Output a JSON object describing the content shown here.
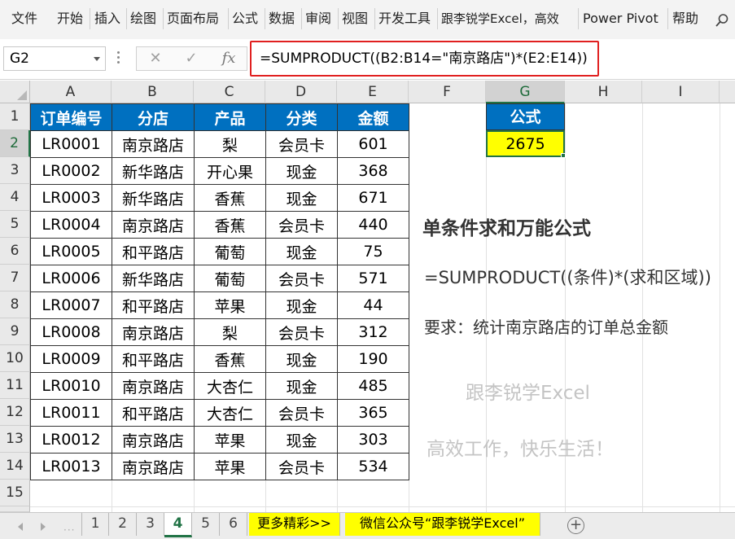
{
  "ribbon": {
    "tabs": [
      "文件",
      "开始",
      "插入",
      "绘图",
      "页面布局",
      "公式",
      "数据",
      "审阅",
      "视图",
      "开发工具",
      "跟李锐学Excel，高效",
      "Power Pivot",
      "帮助"
    ],
    "search_icon": "search-icon"
  },
  "formula_bar": {
    "name_box": "G2",
    "cancel_glyph": "✕",
    "enter_glyph": "✓",
    "fx_glyph": "fx",
    "formula": "=SUMPRODUCT((B2:B14=\"南京路店\")*(E2:E14))"
  },
  "grid": {
    "columns": [
      "A",
      "B",
      "C",
      "D",
      "E",
      "F",
      "G",
      "H",
      "I"
    ],
    "rows": [
      "1",
      "2",
      "3",
      "4",
      "5",
      "6",
      "7",
      "8",
      "9",
      "10",
      "11",
      "12",
      "13",
      "14",
      "15"
    ],
    "selected_cell": "G2"
  },
  "table": {
    "headers": [
      "订单编号",
      "分店",
      "产品",
      "分类",
      "金额"
    ],
    "rows": [
      [
        "LR0001",
        "南京路店",
        "梨",
        "会员卡",
        "601"
      ],
      [
        "LR0002",
        "新华路店",
        "开心果",
        "现金",
        "368"
      ],
      [
        "LR0003",
        "新华路店",
        "香蕉",
        "现金",
        "671"
      ],
      [
        "LR0004",
        "南京路店",
        "香蕉",
        "会员卡",
        "440"
      ],
      [
        "LR0005",
        "和平路店",
        "葡萄",
        "现金",
        "75"
      ],
      [
        "LR0006",
        "新华路店",
        "葡萄",
        "会员卡",
        "571"
      ],
      [
        "LR0007",
        "和平路店",
        "苹果",
        "现金",
        "44"
      ],
      [
        "LR0008",
        "南京路店",
        "梨",
        "会员卡",
        "312"
      ],
      [
        "LR0009",
        "和平路店",
        "香蕉",
        "现金",
        "190"
      ],
      [
        "LR0010",
        "南京路店",
        "大杏仁",
        "现金",
        "485"
      ],
      [
        "LR0011",
        "和平路店",
        "大杏仁",
        "会员卡",
        "365"
      ],
      [
        "LR0012",
        "南京路店",
        "苹果",
        "现金",
        "303"
      ],
      [
        "LR0013",
        "南京路店",
        "苹果",
        "会员卡",
        "534"
      ]
    ]
  },
  "result": {
    "header": "公式",
    "value": "2675"
  },
  "notes": {
    "title": "单条件求和万能公式",
    "formula": "=SUMPRODUCT((条件)*(求和区域))",
    "requirement": "要求：统计南京路店的订单总金额",
    "watermark_line1": "跟李锐学Excel",
    "watermark_line2": "高效工作，快乐生活！"
  },
  "sheet_tabs": {
    "tabs": [
      "1",
      "2",
      "3",
      "4",
      "5",
      "6",
      "更多精彩>>",
      "微信公众号“跟李锐学Excel”"
    ],
    "active": "4",
    "add_glyph": "+"
  },
  "colors": {
    "header_blue": "#0070c0",
    "highlight_yellow": "#ffff00",
    "excel_green": "#217346",
    "formula_border_red": "#e02020"
  }
}
